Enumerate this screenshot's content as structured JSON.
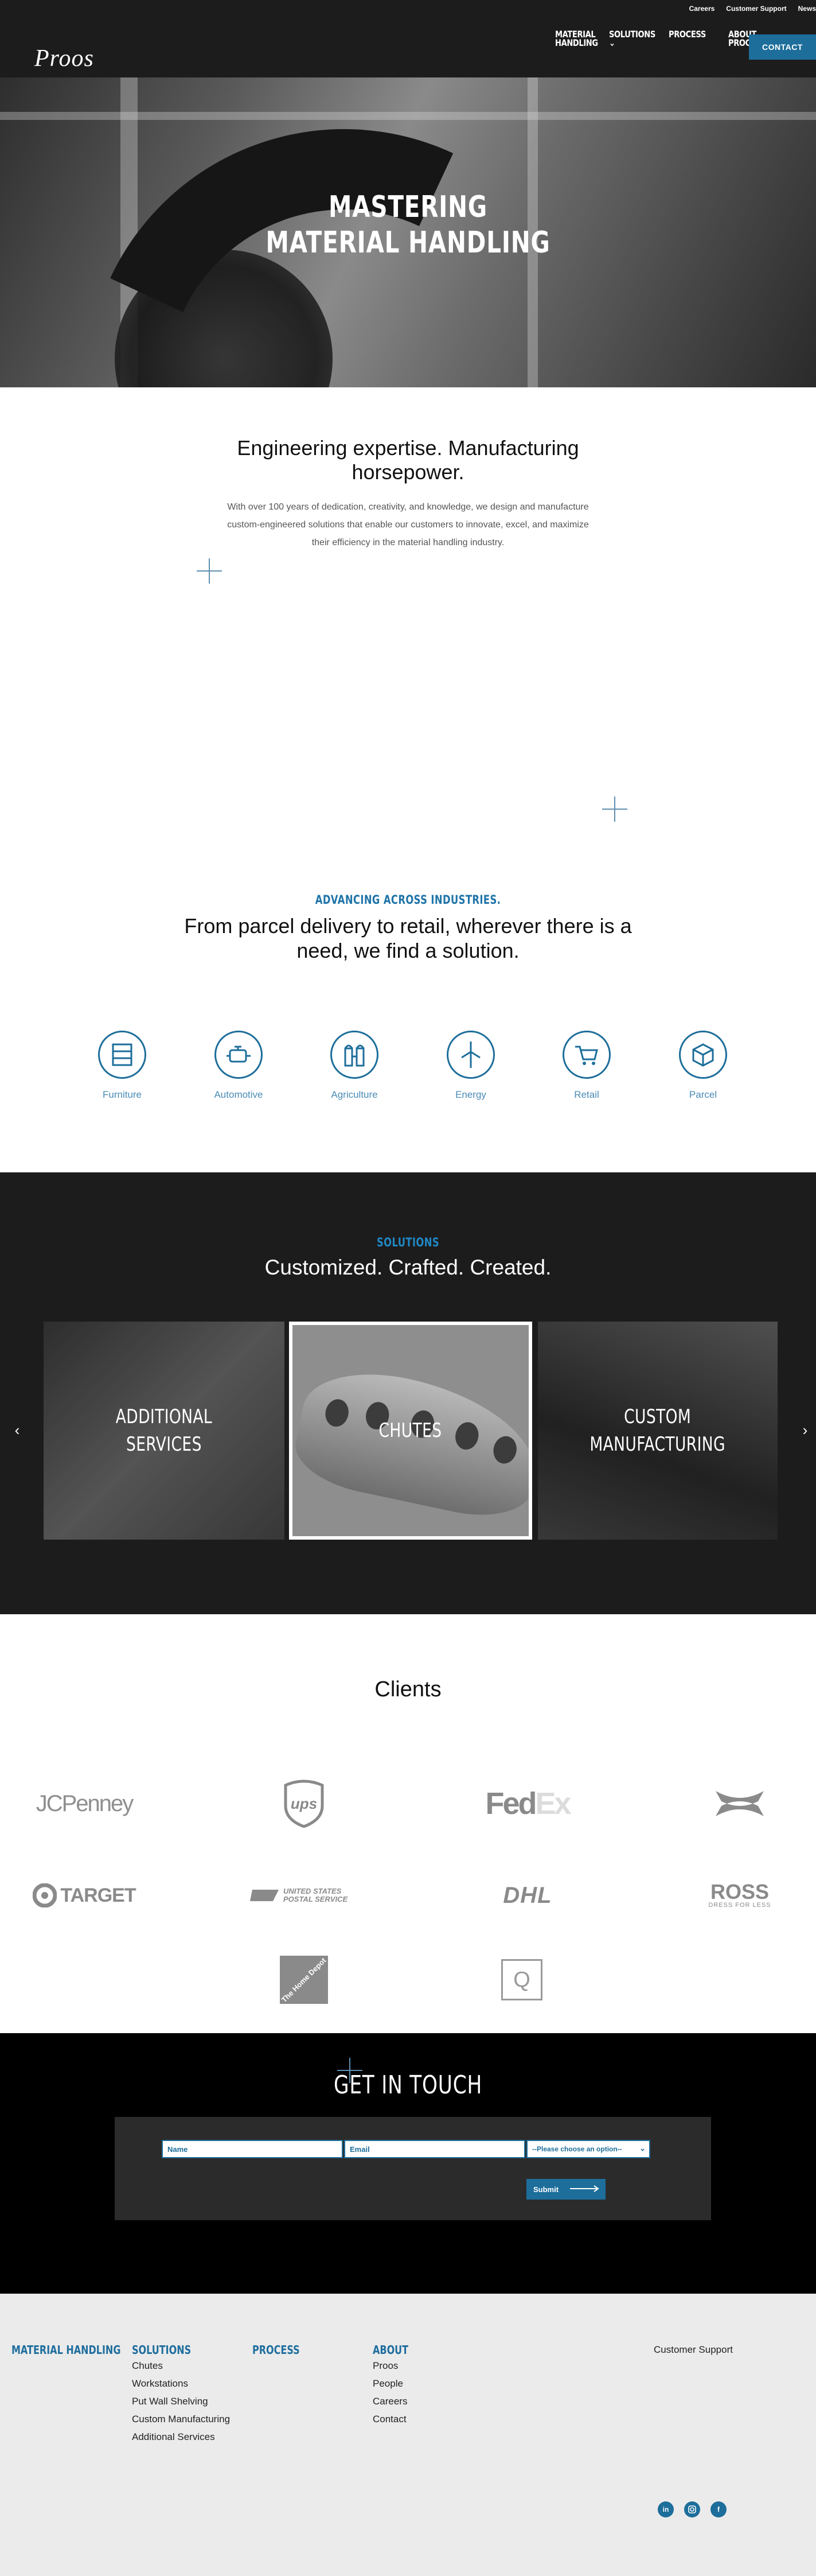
{
  "header": {
    "util_links": [
      "Careers",
      "Customer Support",
      "News"
    ],
    "logo_text": "PROOS",
    "nav": [
      "MATERIAL HANDLING",
      "SOLUTIONS",
      "PROCESS",
      "ABOUT PROOS"
    ],
    "contact_label": "CONTACT"
  },
  "hero": {
    "title_line1": "MASTERING",
    "title_line2": "MATERIAL HANDLING"
  },
  "intro": {
    "heading": "Engineering expertise. Manufacturing horsepower.",
    "body": "With over 100 years of dedication, creativity, and knowledge, we design and manufacture custom-engineered solutions that enable our customers to innovate, excel, and maximize their efficiency in the material handling industry."
  },
  "industries": {
    "eyebrow": "ADVANCING ACROSS INDUSTRIES.",
    "heading": "From parcel delivery to retail, wherever there is a need, we find a solution.",
    "items": [
      {
        "label": "Furniture",
        "icon": "furniture-icon"
      },
      {
        "label": "Automotive",
        "icon": "engine-icon"
      },
      {
        "label": "Agriculture",
        "icon": "silo-icon"
      },
      {
        "label": "Energy",
        "icon": "wind-turbine-icon"
      },
      {
        "label": "Retail",
        "icon": "cart-icon"
      },
      {
        "label": "Parcel",
        "icon": "box-icon"
      }
    ]
  },
  "solutions": {
    "eyebrow": "SOLUTIONS",
    "heading": "Customized. Crafted. Created.",
    "slides": [
      {
        "line1": "ADDITIONAL",
        "line2": "SERVICES"
      },
      {
        "line1": "CHUTES",
        "line2": ""
      },
      {
        "line1": "CUSTOM",
        "line2": "MANUFACTURING"
      }
    ]
  },
  "clients": {
    "heading": "Clients",
    "logos": [
      "JCPenney",
      "ups",
      "FedEx",
      "Under Armour",
      "TARGET",
      "UNITED STATES POSTAL SERVICE",
      "DHL",
      "ROSS",
      "DRESS FOR LESS",
      "The Home Depot",
      "Q"
    ]
  },
  "contact": {
    "heading": "GET IN TOUCH",
    "name_placeholder": "Name",
    "email_placeholder": "Email",
    "select_value": "--Please choose an option--",
    "submit_label": "Submit"
  },
  "footer": {
    "col1_heading": "MATERIAL HANDLING",
    "col2_heading": "SOLUTIONS",
    "col2_links": [
      "Chutes",
      "Workstations",
      "Put Wall Shelving",
      "Custom Manufacturing",
      "Additional Services"
    ],
    "col3_heading": "PROCESS",
    "col4_heading": "ABOUT",
    "col4_links": [
      "Proos",
      "People",
      "Careers",
      "Contact"
    ],
    "support": "Customer Support",
    "social": [
      "linkedin-icon",
      "instagram-icon",
      "facebook-icon"
    ]
  },
  "colors": {
    "accent": "#1d6e9b",
    "dark": "#1c1c1c",
    "footer_bg": "#ebebeb"
  }
}
